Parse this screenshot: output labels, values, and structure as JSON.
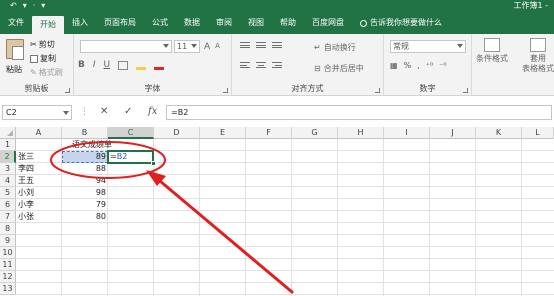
{
  "window": {
    "qat": [
      "↶",
      "▾",
      "·",
      "▾"
    ],
    "title": "工作簿1 -"
  },
  "menu": {
    "tabs": [
      "文件",
      "开始",
      "插入",
      "页面布局",
      "公式",
      "数据",
      "审阅",
      "视图",
      "帮助",
      "百度网盘"
    ],
    "active_tab": "开始",
    "tell_me": "告诉我你想要做什么"
  },
  "ribbon": {
    "clipboard": {
      "paste": "粘贴",
      "cut": "剪切",
      "copy": "复制",
      "format_painter": "格式刷",
      "label": "剪贴板"
    },
    "font": {
      "font_name": "",
      "font_size": "11",
      "grow": "A",
      "shrink": "A",
      "bold": "B",
      "italic": "I",
      "underline": "U",
      "label": "字体"
    },
    "alignment": {
      "wrap_text": "自动换行",
      "merge_center": "合并后居中",
      "label": "对齐方式"
    },
    "number": {
      "format": "常规",
      "percent": "%",
      "comma": ",",
      "label": "数字"
    },
    "styles": {
      "conditional_formatting": "条件格式",
      "table_format_line1": "套用",
      "table_format_line2": "表格格式"
    }
  },
  "formula_bar": {
    "name_box": "C2",
    "cancel": "✕",
    "enter": "✓",
    "fx": "fx",
    "formula": "=B2"
  },
  "grid": {
    "columns": [
      "A",
      "B",
      "C",
      "D",
      "E",
      "F",
      "G",
      "H",
      "I",
      "J",
      "K",
      "L"
    ],
    "rows": [
      "1",
      "2",
      "3",
      "4",
      "5",
      "6",
      "7",
      "8",
      "9",
      "10",
      "11",
      "12",
      "13",
      "14"
    ],
    "title_cell": "语文成绩单",
    "names": [
      "张三",
      "李四",
      "王五",
      "小刘",
      "小李",
      "小张"
    ],
    "scores": [
      "89",
      "88",
      "94",
      "98",
      "79",
      "80"
    ],
    "active_cell_formula_eq": "=",
    "active_cell_formula_ref": "B2"
  },
  "colors": {
    "excel_green": "#217346",
    "annotation_red": "#e02020",
    "ref_blue": "#4472c4"
  }
}
